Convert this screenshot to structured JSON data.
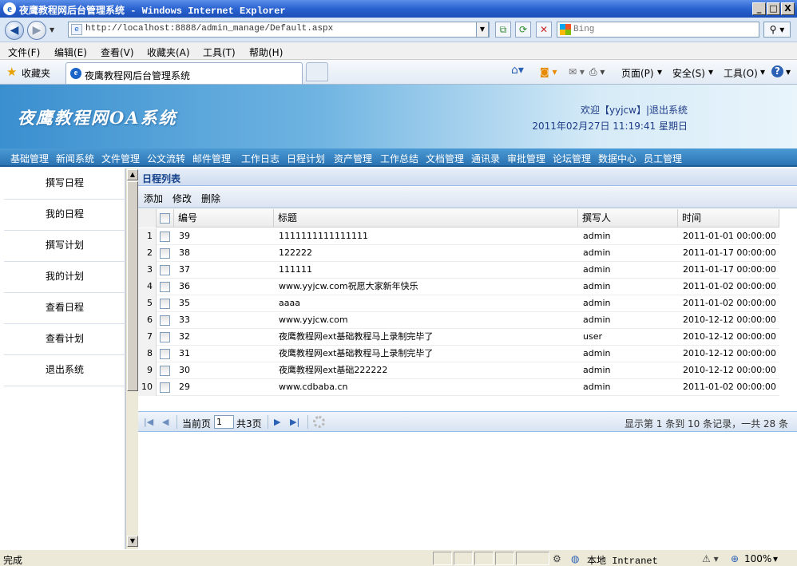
{
  "window": {
    "title": "夜鹰教程网后台管理系统 - Windows Internet Explorer",
    "min_label": "_",
    "max_label": "□",
    "close_label": "X"
  },
  "browser": {
    "url": "http://localhost:8888/admin_manage/Default.aspx",
    "search_placeholder": "Bing",
    "menu": [
      "文件(F)",
      "编辑(E)",
      "查看(V)",
      "收藏夹(A)",
      "工具(T)",
      "帮助(H)"
    ],
    "favorites_label": "收藏夹",
    "tab_title": "夜鹰教程网后台管理系统",
    "commands": [
      "页面(P)",
      "安全(S)",
      "工具(O)"
    ],
    "status_text": "完成",
    "zone_text": "本地 Intranet",
    "zoom_text": "100%"
  },
  "app": {
    "logo_text": "夜鹰教程网OA系统",
    "welcome_prefix": "欢迎【",
    "username": "yyjcw",
    "welcome_suffix": "】|",
    "logout_link": "退出系统",
    "datetime": "2011年02月27日 11:19:41 星期日",
    "nav": [
      "基础管理",
      "新闻系统",
      "文件管理",
      "公文流转",
      "邮件管理",
      "工作日志",
      "日程计划",
      "资产管理",
      "工作总结",
      "文档管理",
      "通讯录",
      "审批管理",
      "论坛管理",
      "数据中心",
      "员工管理"
    ],
    "sidebar": [
      "撰写日程",
      "我的日程",
      "撰写计划",
      "我的计划",
      "查看日程",
      "查看计划",
      "退出系统"
    ]
  },
  "grid": {
    "title": "日程列表",
    "toolbar": [
      "添加",
      "修改",
      "删除"
    ],
    "columns": [
      "编号",
      "标题",
      "撰写人",
      "时间"
    ],
    "rows": [
      {
        "n": "1",
        "id": "39",
        "title": "1111111111111111",
        "author": "admin",
        "time": "2011-01-01 00:00:00"
      },
      {
        "n": "2",
        "id": "38",
        "title": "122222",
        "author": "admin",
        "time": "2011-01-17 00:00:00"
      },
      {
        "n": "3",
        "id": "37",
        "title": "111111",
        "author": "admin",
        "time": "2011-01-17 00:00:00"
      },
      {
        "n": "4",
        "id": "36",
        "title": "www.yyjcw.com祝愿大家新年快乐",
        "author": "admin",
        "time": "2011-01-02 00:00:00"
      },
      {
        "n": "5",
        "id": "35",
        "title": "aaaa",
        "author": "admin",
        "time": "2011-01-02 00:00:00"
      },
      {
        "n": "6",
        "id": "33",
        "title": "www.yyjcw.com",
        "author": "admin",
        "time": "2010-12-12 00:00:00"
      },
      {
        "n": "7",
        "id": "32",
        "title": "夜鹰教程网ext基础教程马上录制完毕了",
        "author": "user",
        "time": "2010-12-12 00:00:00"
      },
      {
        "n": "8",
        "id": "31",
        "title": "夜鹰教程网ext基础教程马上录制完毕了",
        "author": "admin",
        "time": "2010-12-12 00:00:00"
      },
      {
        "n": "9",
        "id": "30",
        "title": "夜鹰教程网ext基础222222",
        "author": "admin",
        "time": "2010-12-12 00:00:00"
      },
      {
        "n": "10",
        "id": "29",
        "title": "www.cdbaba.cn",
        "author": "admin",
        "time": "2011-01-02 00:00:00"
      }
    ]
  },
  "pager": {
    "current_label": "当前页",
    "current_page": "1",
    "total_label": "共3页",
    "info": "显示第 1 条到 10 条记录，一共 28 条"
  }
}
